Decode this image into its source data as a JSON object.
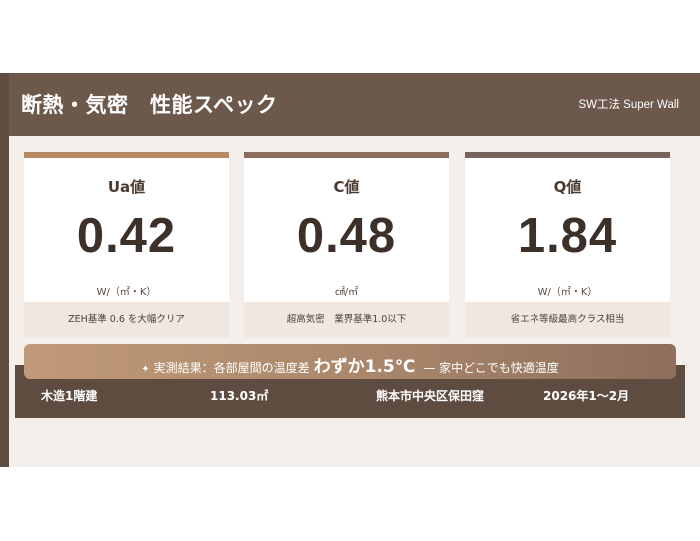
{
  "header": {
    "title": "断熱・気密　性能スペック",
    "subtitle": "SW工法 Super Wall"
  },
  "cards": [
    {
      "label": "Ua値",
      "value": "0.42",
      "unit": "W/（㎡・K）",
      "note": "ZEH基準 0.6 を大幅クリア",
      "accent": "#b58a65"
    },
    {
      "label": "C値",
      "value": "0.48",
      "unit": "㎠/㎡",
      "note": "超高気密　業界基準1.0以下",
      "accent": "#8a6d5b"
    },
    {
      "label": "Q値",
      "value": "1.84",
      "unit": "W/（㎡・K）",
      "note": "省エネ等級最高クラス相当",
      "accent": "#75655a"
    }
  ],
  "banner": {
    "icon": "sparkle-icon",
    "star": "✦",
    "lead": "実測結果：各部屋間の温度差",
    "emphasis": "わずか1.5℃",
    "tail": "— 家中どこでも快適温度"
  },
  "info": {
    "structure": "木造1階建",
    "area": "113.03㎡",
    "location": "熊本市中央区保田窪",
    "period": "2026年1〜2月"
  },
  "colors": {
    "header_bg": "#6d594b",
    "panel_bg": "#f4efea",
    "info_bar_bg": "#5f4c40",
    "banner_start": "#c09a78",
    "banner_end": "#8c6f5c"
  }
}
